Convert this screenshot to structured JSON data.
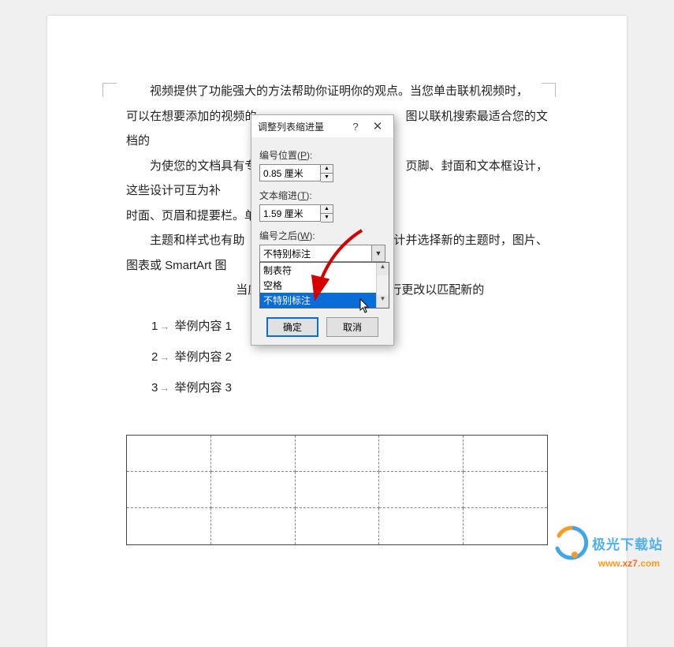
{
  "document": {
    "para1_a": "视频提供了功能强大的方法帮助你证明你的观点。当您单击联机视频时，",
    "para1_b": "可以在想要添加的视频的",
    "para1_c": "图以联机搜索最适合您的文档的",
    "para2_a": "为使您的文档具有专",
    "para2_b": "页脚、封面和文本框设计，这些设计可互为补",
    "para2_c": "时面、页眉和提要栏。单击\"插入\"，然后从不同",
    "para3_a": "主题和样式也有助",
    "para3_b": "计并选择新的主题时，图片、图表或 SmartArt 图",
    "para3_c": "当应用样式时，您的标题会进行更改以匹配新的",
    "list": [
      {
        "num": "1",
        "text": "举例内容 1"
      },
      {
        "num": "2",
        "text": "举例内容 2"
      },
      {
        "num": "3",
        "text": "举例内容 3"
      }
    ]
  },
  "dialog": {
    "title": "调整列表缩进量",
    "labels": {
      "number_pos": "编号位置",
      "number_pos_key": "P",
      "text_indent": "文本缩进",
      "text_indent_key": "T",
      "after_number": "编号之后",
      "after_number_key": "W"
    },
    "values": {
      "number_pos": "0.85 厘米",
      "text_indent": "1.59 厘米",
      "after_number_selected": "不特别标注"
    },
    "dropdown_options": [
      "制表符",
      "空格",
      "不特别标注"
    ],
    "buttons": {
      "ok": "确定",
      "cancel": "取消"
    }
  },
  "watermark": {
    "brand": "极光下载站",
    "url": "www.xz7.com"
  }
}
